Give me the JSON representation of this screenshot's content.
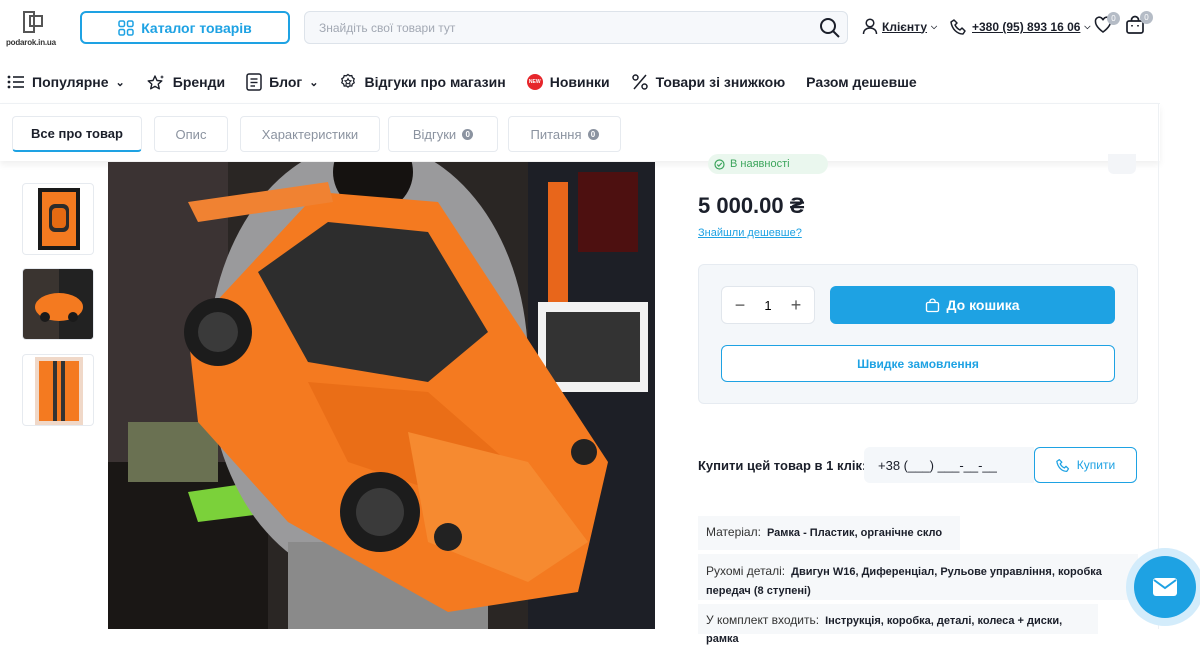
{
  "header": {
    "logo_text": "podarok.in.ua",
    "catalog_label": "Каталог товарів",
    "search": {
      "placeholder": "Знайдіть свої товари тут",
      "value": ""
    },
    "client_label": "Клієнту",
    "phone": "+380 (95) 893 16 06",
    "wishlist_count": "0",
    "cart_count": "0"
  },
  "nav": {
    "items": [
      {
        "label": "Популярне",
        "icon": "list-icon",
        "dropdown": true
      },
      {
        "label": "Бренди",
        "icon": "stars-icon",
        "dropdown": false
      },
      {
        "label": "Блог",
        "icon": "document-icon",
        "dropdown": true
      },
      {
        "label": "Відгуки про магазин",
        "icon": "review-icon",
        "dropdown": false
      },
      {
        "label": "Новинки",
        "icon": "new-badge-icon",
        "dropdown": false,
        "badge": "NEW"
      },
      {
        "label": "Товари зі знижкою",
        "icon": "percent-icon",
        "dropdown": false
      },
      {
        "label": "Разом дешевше",
        "icon": "",
        "dropdown": false
      }
    ]
  },
  "tabs": [
    {
      "label": "Все про товар",
      "active": true
    },
    {
      "label": "Опис",
      "active": false
    },
    {
      "label": "Характеристики",
      "active": false
    },
    {
      "label": "Відгуки",
      "active": false,
      "count": "0"
    },
    {
      "label": "Питання",
      "active": false,
      "count": "0"
    }
  ],
  "product": {
    "stock_status": "В наявності",
    "price": "5 000.00 ₴",
    "cheaper_link": "Знайшли дешевше?",
    "quantity": "1",
    "to_cart_label": "До кошика",
    "fast_order_label": "Швидке замовлення",
    "one_click_label": "Купити цей товар в 1 клік:",
    "phone_mask": "+38 (___) ___-__-__",
    "buy_label": "Купити",
    "specs": [
      {
        "key": "Матеріал:",
        "value": "Рамка - Пластик, органічне скло"
      },
      {
        "key": "Рухомі деталі:",
        "value": "Двигун W16, Диференціал, Рульове управління, коробка передач (8 ступені)"
      },
      {
        "key": "У комплект входить:",
        "value": "Інструкція, коробка, деталі, колеса + диски, рамка"
      }
    ]
  },
  "colors": {
    "accent": "#1ea2e3",
    "car_orange": "#f47a20",
    "new_badge": "#e6262b",
    "stock_green": "#3ca55c"
  }
}
